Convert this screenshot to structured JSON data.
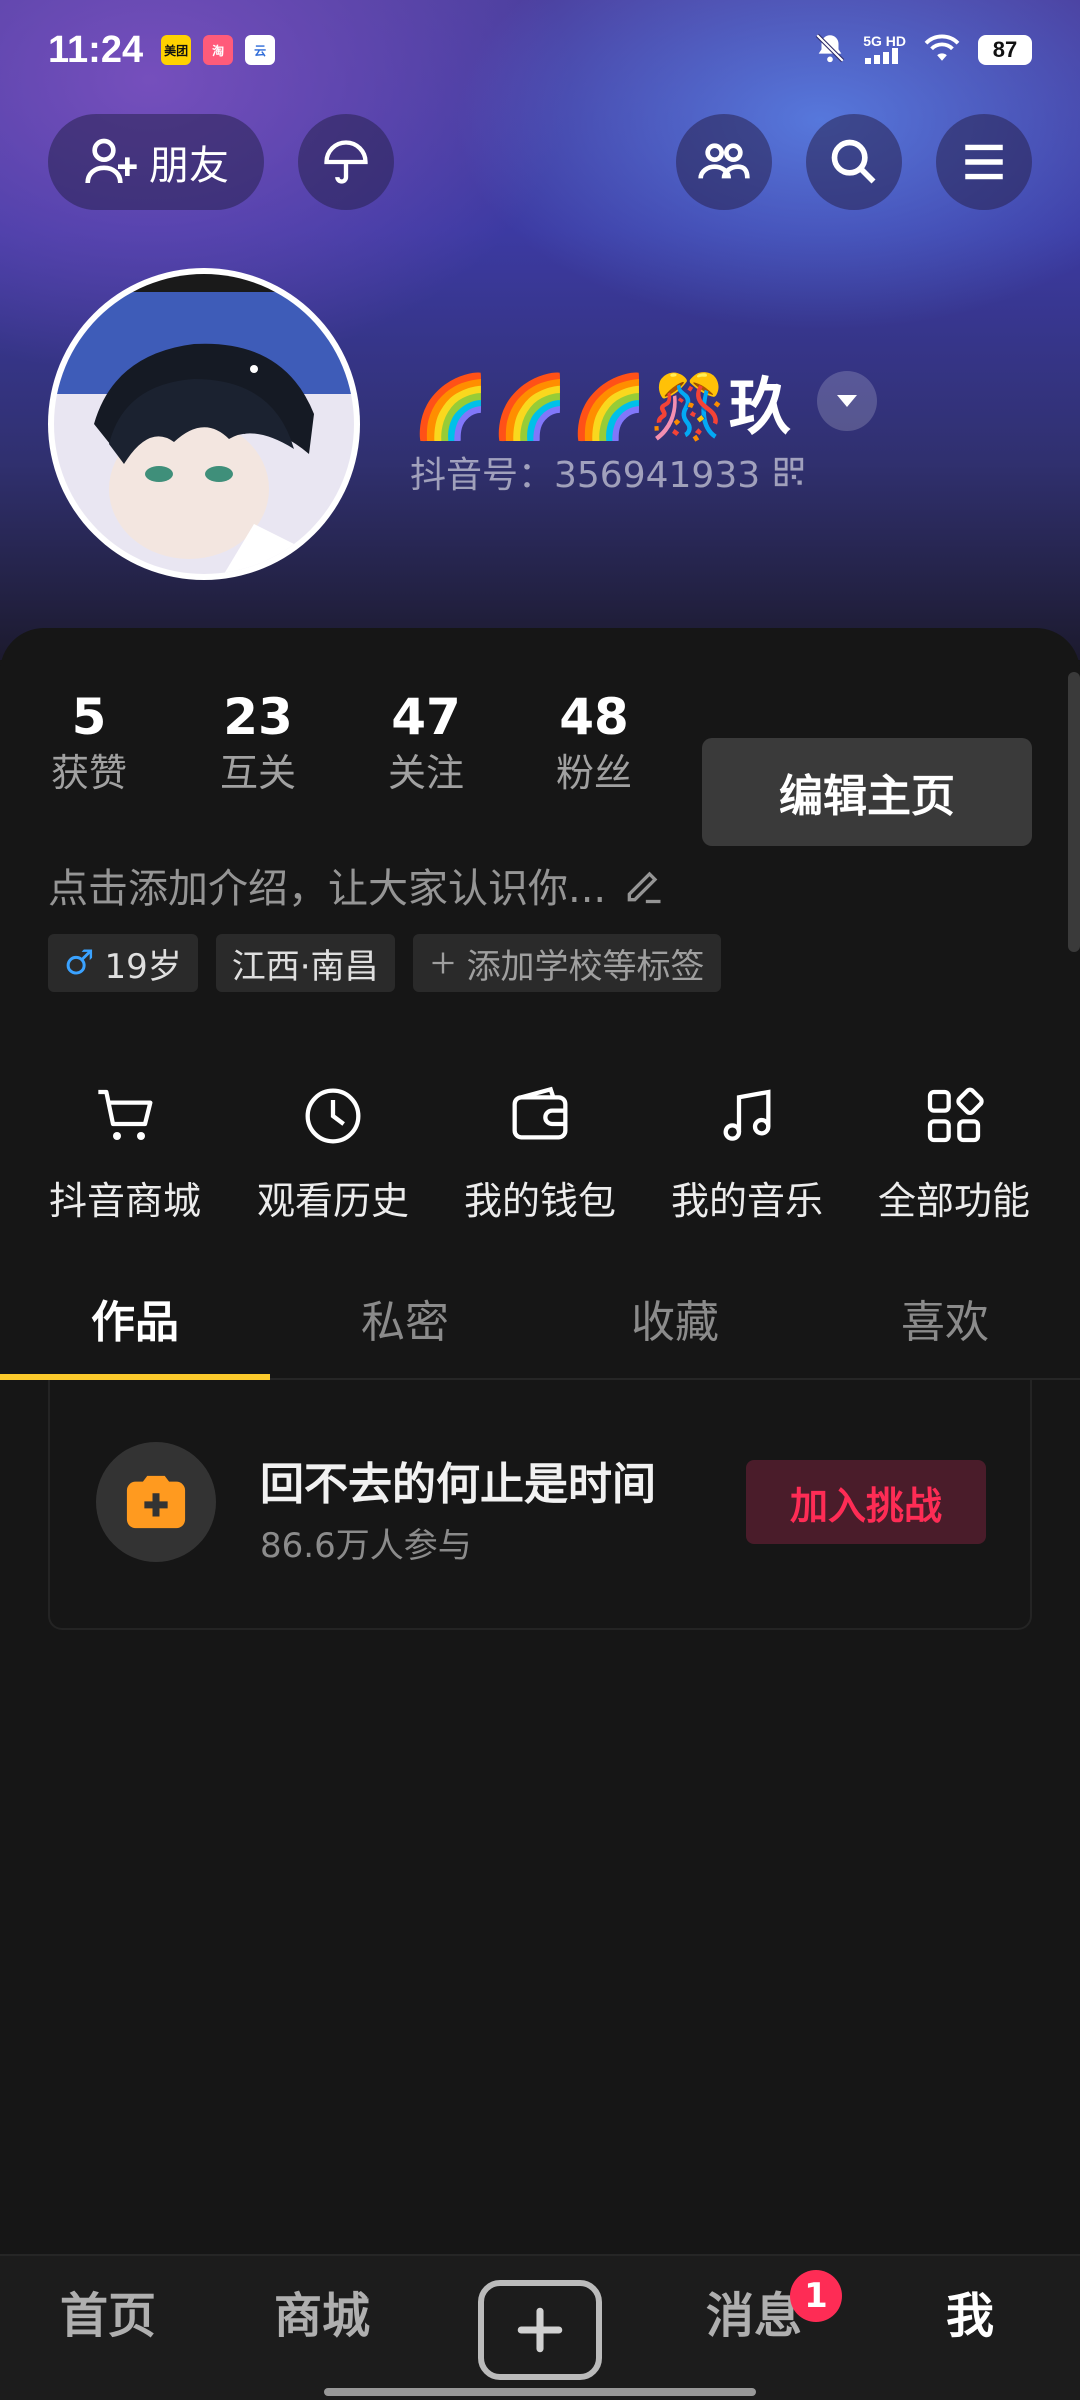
{
  "status_bar": {
    "time": "11:24",
    "apps": [
      "美团",
      "淘",
      "云"
    ],
    "network": "5G HD",
    "battery": "87"
  },
  "topbar": {
    "friends_label": "朋友"
  },
  "profile": {
    "nickname": "🌈🌈🌈🎊玖",
    "douyin_id": "抖音号：356941933",
    "stats": [
      {
        "value": "5",
        "label": "获赞"
      },
      {
        "value": "23",
        "label": "互关"
      },
      {
        "value": "47",
        "label": "关注"
      },
      {
        "value": "48",
        "label": "粉丝"
      }
    ],
    "edit_label": "编辑主页",
    "bio_placeholder": "点击添加介绍，让大家认识你...",
    "tags": {
      "age": "19岁",
      "location": "江西·南昌",
      "add_tag": "添加学校等标签"
    }
  },
  "shortcuts": [
    {
      "label": "抖音商城",
      "icon": "cart-icon"
    },
    {
      "label": "观看历史",
      "icon": "clock-icon"
    },
    {
      "label": "我的钱包",
      "icon": "wallet-icon"
    },
    {
      "label": "我的音乐",
      "icon": "music-icon"
    },
    {
      "label": "全部功能",
      "icon": "grid-icon"
    }
  ],
  "tabs": [
    {
      "label": "作品",
      "active": true
    },
    {
      "label": "私密",
      "active": false
    },
    {
      "label": "收藏",
      "active": false
    },
    {
      "label": "喜欢",
      "active": false
    }
  ],
  "challenge": {
    "title": "回不去的何止是时间",
    "participants": "86.6万人参与",
    "join_label": "加入挑战"
  },
  "bottom_nav": {
    "items": [
      {
        "label": "首页"
      },
      {
        "label": "商城"
      },
      {
        "label": "消息"
      },
      {
        "label": "我"
      }
    ],
    "message_badge": "1"
  },
  "colors": {
    "accent_yellow": "#fcca2b",
    "accent_red": "#fe2c55",
    "background": "#161616"
  }
}
